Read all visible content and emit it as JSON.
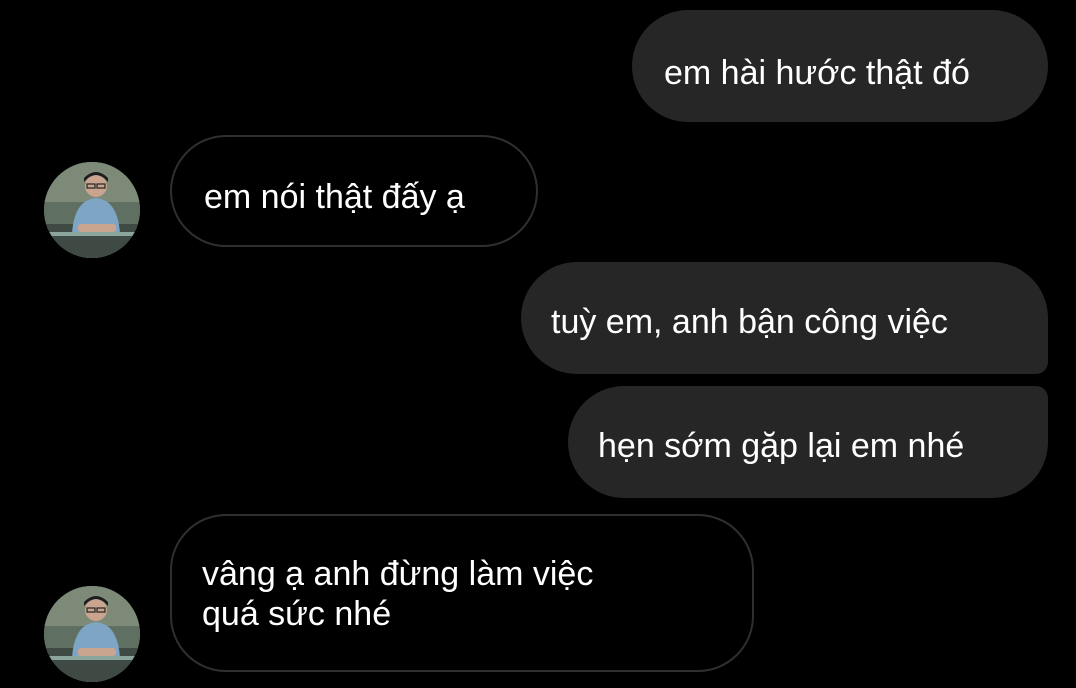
{
  "messages": [
    {
      "side": "sent",
      "text": "em hài hước thật đó"
    },
    {
      "side": "received",
      "text": "em nói thật đấy ạ"
    },
    {
      "side": "sent",
      "text": "tuỳ em, anh bận công việc"
    },
    {
      "side": "sent",
      "text": "hẹn sớm gặp lại em nhé"
    },
    {
      "side": "received",
      "lines": [
        "vâng ạ anh đừng làm việc",
        "quá sức nhé"
      ]
    }
  ],
  "colors": {
    "background": "#000000",
    "sent_bubble": "#262626",
    "received_border": "#2f2f2f",
    "text": "#ffffff"
  },
  "avatar_icon": "contact-avatar-icon"
}
